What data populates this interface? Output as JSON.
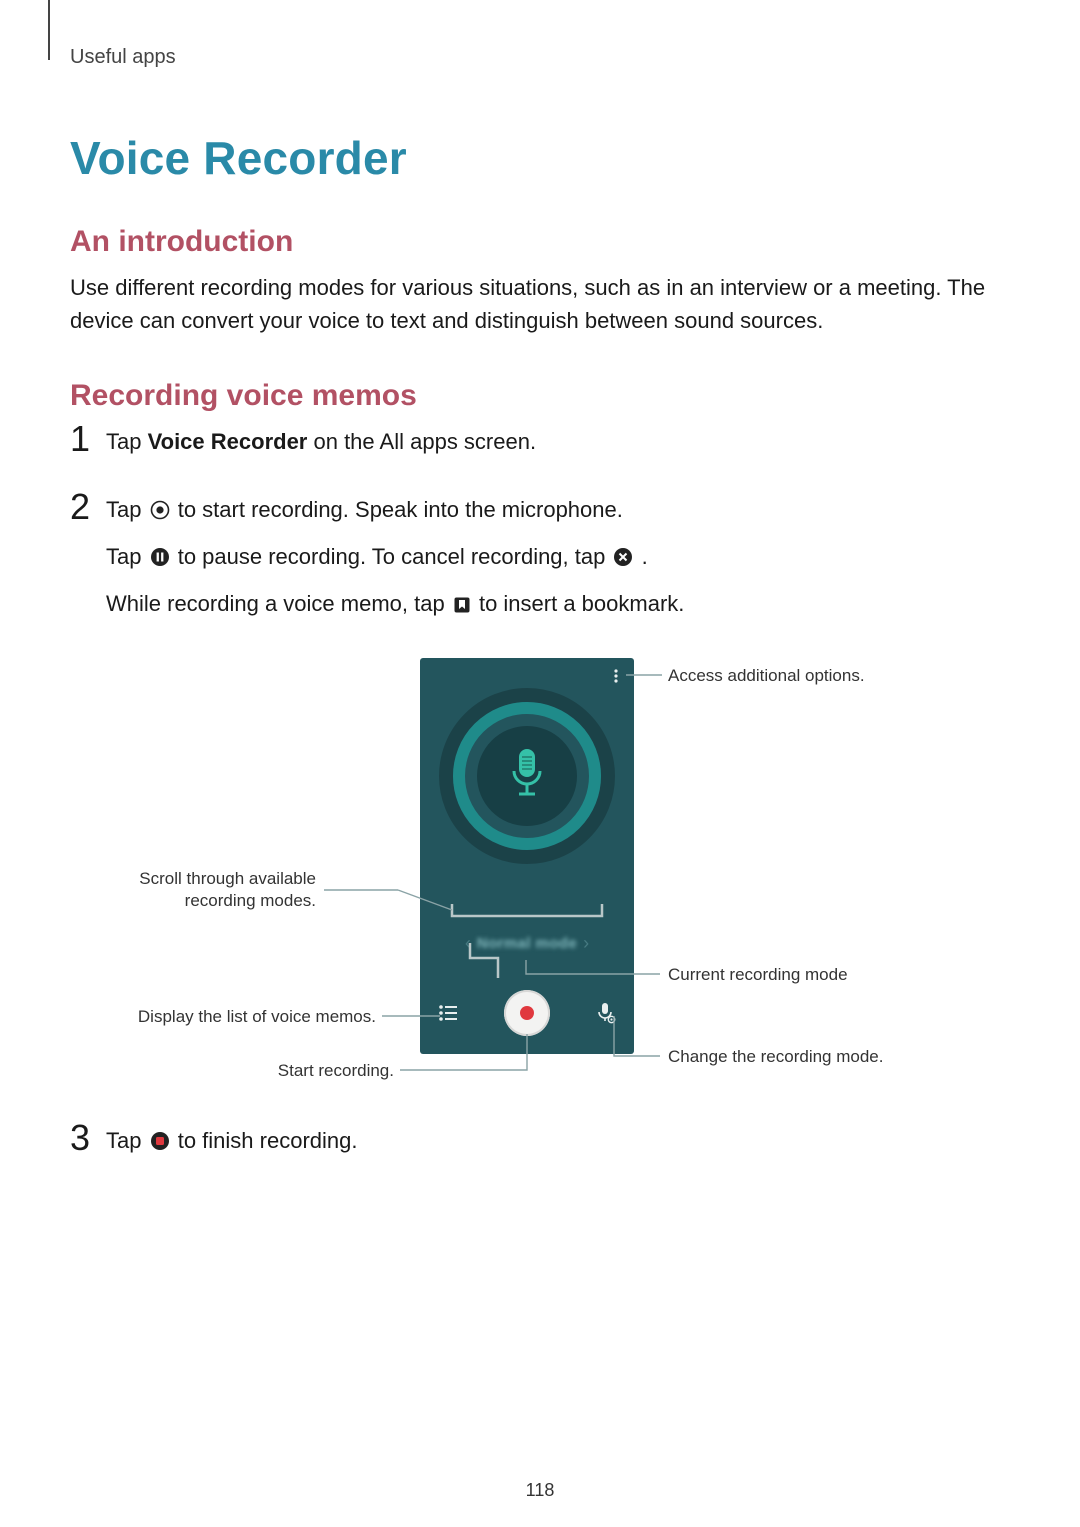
{
  "breadcrumb": "Useful apps",
  "title": "Voice Recorder",
  "sections": {
    "intro_heading": "An introduction",
    "intro_body": "Use different recording modes for various situations, such as in an interview or a meeting. The device can convert your voice to text and distinguish between sound sources.",
    "memos_heading": "Recording voice memos"
  },
  "steps": {
    "s1": {
      "num": "1",
      "pre": "Tap ",
      "bold": "Voice Recorder",
      "post": " on the All apps screen."
    },
    "s2": {
      "num": "2",
      "l1_pre": "Tap ",
      "l1_post": " to start recording. Speak into the microphone.",
      "l2_pre": "Tap ",
      "l2_mid": " to pause recording. To cancel recording, tap ",
      "l2_post": ".",
      "l3_pre": "While recording a voice memo, tap ",
      "l3_post": " to insert a bookmark."
    },
    "s3": {
      "num": "3",
      "pre": "Tap ",
      "post": " to finish recording."
    }
  },
  "diagram": {
    "mode_text": "Normal mode",
    "callouts": {
      "options": "Access additional options.",
      "scroll": "Scroll through available recording modes.",
      "current_mode": "Current recording mode",
      "list": "Display the list of voice memos.",
      "change_mode": "Change the recording mode.",
      "start": "Start recording."
    }
  },
  "page_number": "118"
}
